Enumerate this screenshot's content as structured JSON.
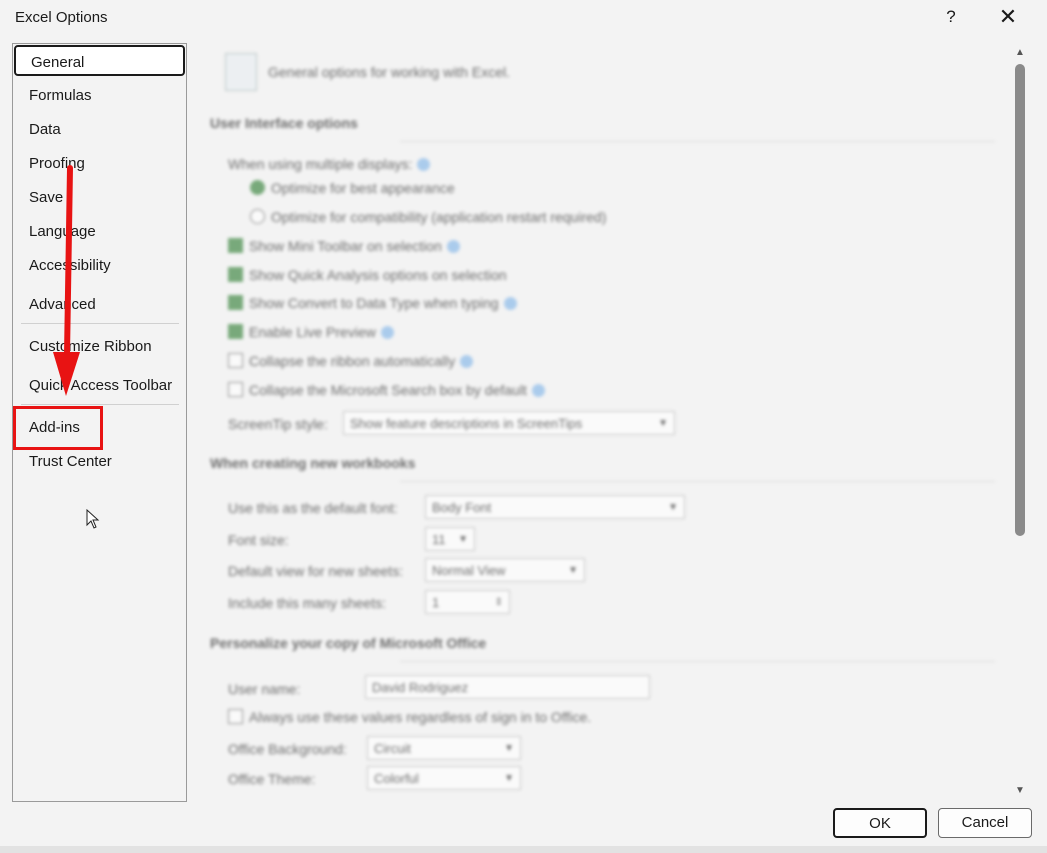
{
  "dialog": {
    "title": "Excel Options",
    "help_label": "?",
    "close_label": "✕"
  },
  "nav": {
    "items": [
      {
        "label": "General"
      },
      {
        "label": "Formulas"
      },
      {
        "label": "Data"
      },
      {
        "label": "Proofing"
      },
      {
        "label": "Save"
      },
      {
        "label": "Language"
      },
      {
        "label": "Accessibility"
      },
      {
        "label": "Advanced"
      },
      {
        "label": "Customize Ribbon"
      },
      {
        "label": "Quick Access Toolbar"
      },
      {
        "label": "Add-ins"
      },
      {
        "label": "Trust Center"
      }
    ],
    "selected": "General",
    "highlighted": "Add-ins"
  },
  "content": {
    "intro": "General options for working with Excel.",
    "ui_section": {
      "heading": "User Interface options",
      "multiple_displays_label": "When using multiple displays:",
      "radio_best_appearance": "Optimize for best appearance",
      "radio_compatibility": "Optimize for compatibility (application restart required)",
      "mini_toolbar": "Show Mini Toolbar on selection",
      "quick_analysis": "Show Quick Analysis options on selection",
      "convert_data_types": "Show Convert to Data Type when typing",
      "live_preview": "Enable Live Preview",
      "collapse_ribbon": "Collapse the ribbon automatically",
      "collapse_search": "Collapse the Microsoft Search box by default",
      "screentip_label": "ScreenTip style:",
      "screentip_value": "Show feature descriptions in ScreenTips"
    },
    "new_workbooks": {
      "heading": "When creating new workbooks",
      "font_label": "Use this as the default font:",
      "font_value": "Body Font",
      "size_label": "Font size:",
      "size_value": "11",
      "view_label": "Default view for new sheets:",
      "view_value": "Normal View",
      "sheets_label": "Include this many sheets:",
      "sheets_value": "1"
    },
    "personalize": {
      "heading": "Personalize your copy of Microsoft Office",
      "username_label": "User name:",
      "username_value": "David Rodriguez",
      "always_use_label": "Always use these values regardless of sign in to Office.",
      "background_label": "Office Background:",
      "background_value": "Circuit",
      "theme_label": "Office Theme:",
      "theme_value": "Colorful"
    }
  },
  "footer": {
    "ok_label": "OK",
    "cancel_label": "Cancel"
  },
  "annotation": {
    "arrow_color": "#e81313",
    "highlight_color": "#e81313"
  }
}
